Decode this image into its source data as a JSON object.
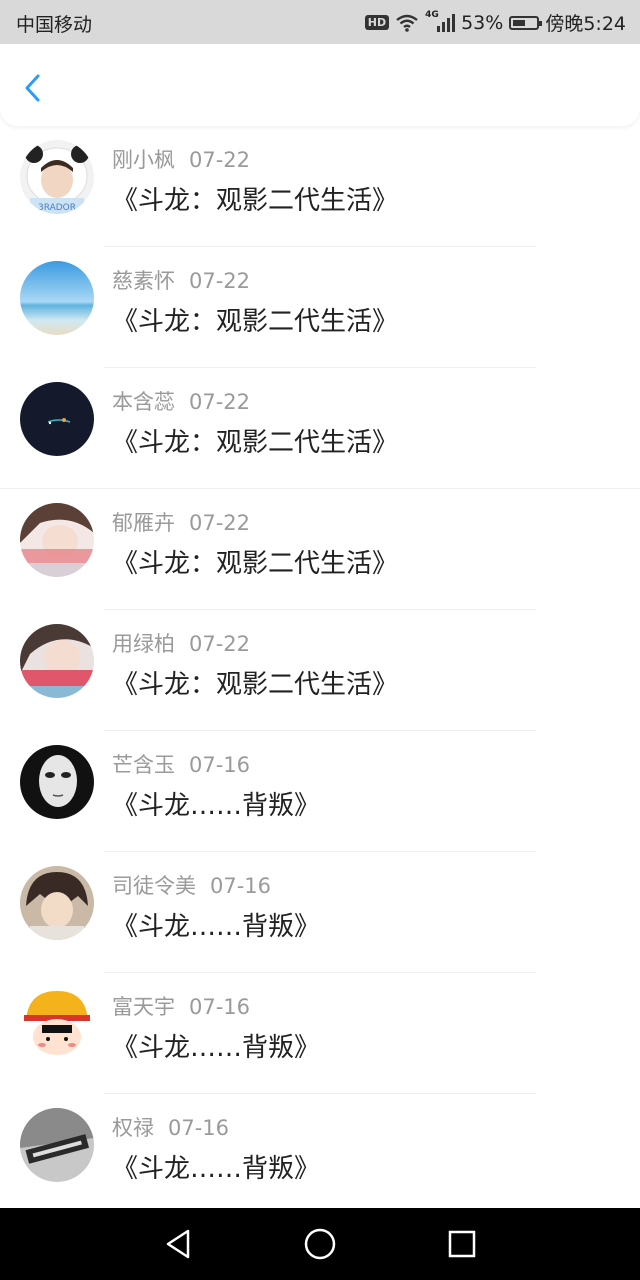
{
  "status_bar": {
    "carrier": "中国移动",
    "hd": "HD",
    "network": "4G",
    "battery_percent": "53%",
    "battery_level": 0.53,
    "time": "傍晚5:24"
  },
  "header": {
    "back_icon": "chevron-left-icon",
    "accent_color": "#2a9df4"
  },
  "messages": [
    {
      "name": "刚小枫",
      "date": "07-22",
      "title": "《斗龙：观影二代生活》",
      "avatar": "avatar-panda-hood"
    },
    {
      "name": "慈素怀",
      "date": "07-22",
      "title": "《斗龙：观影二代生活》",
      "avatar": "avatar-beach-sky"
    },
    {
      "name": "本含蕊",
      "date": "07-22",
      "title": "《斗龙：观影二代生活》",
      "avatar": "avatar-dark-night"
    },
    {
      "name": "郁雁卉",
      "date": "07-22",
      "title": "《斗龙：观影二代生活》",
      "avatar": "avatar-girl-pink"
    },
    {
      "name": "用绿柏",
      "date": "07-22",
      "title": "《斗龙：观影二代生活》",
      "avatar": "avatar-girl-red"
    },
    {
      "name": "芒含玉",
      "date": "07-16",
      "title": "《斗龙……背叛》",
      "avatar": "avatar-white-mask"
    },
    {
      "name": "司徒令美",
      "date": "07-16",
      "title": "《斗龙……背叛》",
      "avatar": "avatar-anime-boy"
    },
    {
      "name": "富天宇",
      "date": "07-16",
      "title": "《斗龙……背叛》",
      "avatar": "avatar-cartoon-hat"
    },
    {
      "name": "权禄",
      "date": "07-16",
      "title": "《斗龙……背叛》",
      "avatar": "avatar-bw-text"
    }
  ],
  "nav": {
    "back": "triangle-back-icon",
    "home": "circle-home-icon",
    "recents": "square-recents-icon"
  }
}
